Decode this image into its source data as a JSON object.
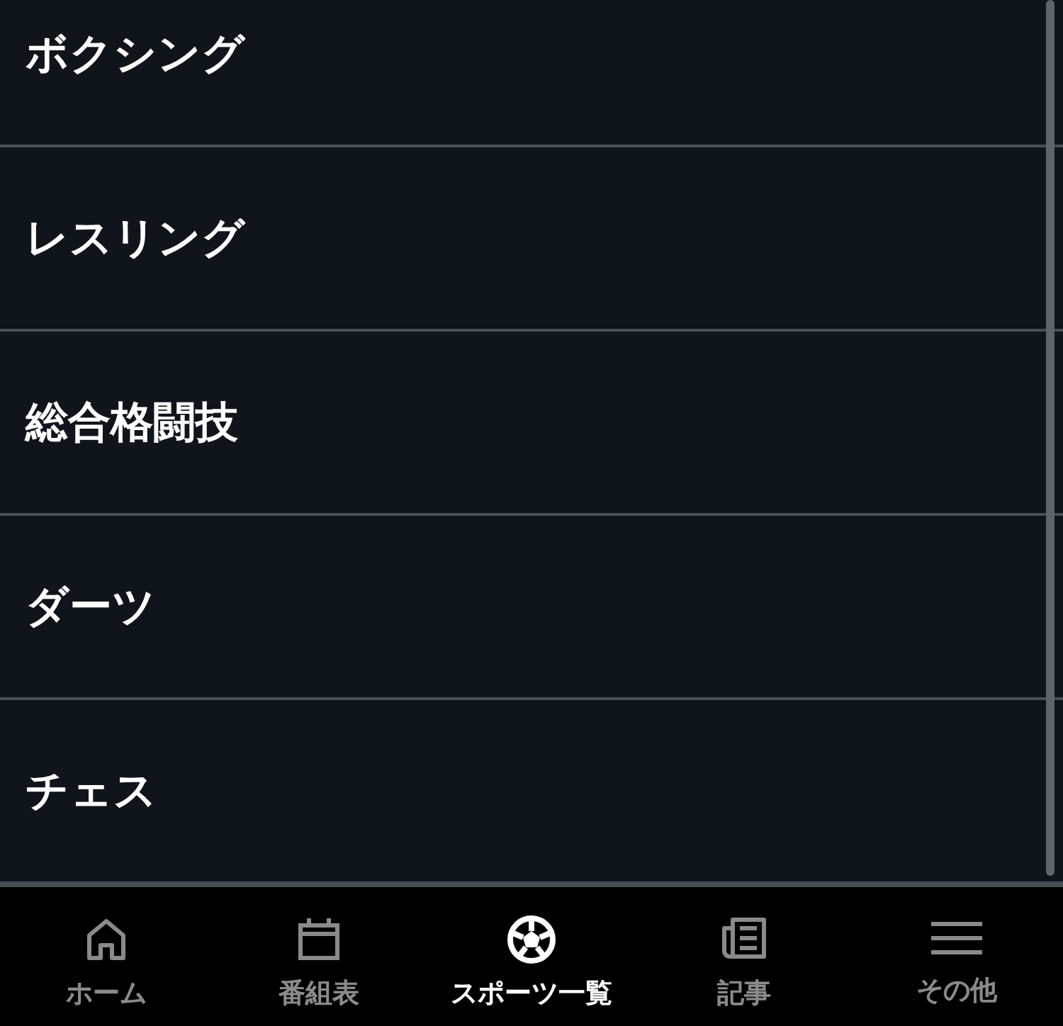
{
  "list": [
    {
      "label": "ボクシング"
    },
    {
      "label": "レスリング"
    },
    {
      "label": "総合格闘技"
    },
    {
      "label": "ダーツ"
    },
    {
      "label": "チェス"
    }
  ],
  "nav": [
    {
      "kind": "home",
      "label": "ホーム",
      "selected": false
    },
    {
      "kind": "calendar",
      "label": "番組表",
      "selected": false
    },
    {
      "kind": "ball",
      "label": "スポーツ一覧",
      "selected": true
    },
    {
      "kind": "news",
      "label": "記事",
      "selected": false
    },
    {
      "kind": "menu",
      "label": "その他",
      "selected": false
    }
  ]
}
